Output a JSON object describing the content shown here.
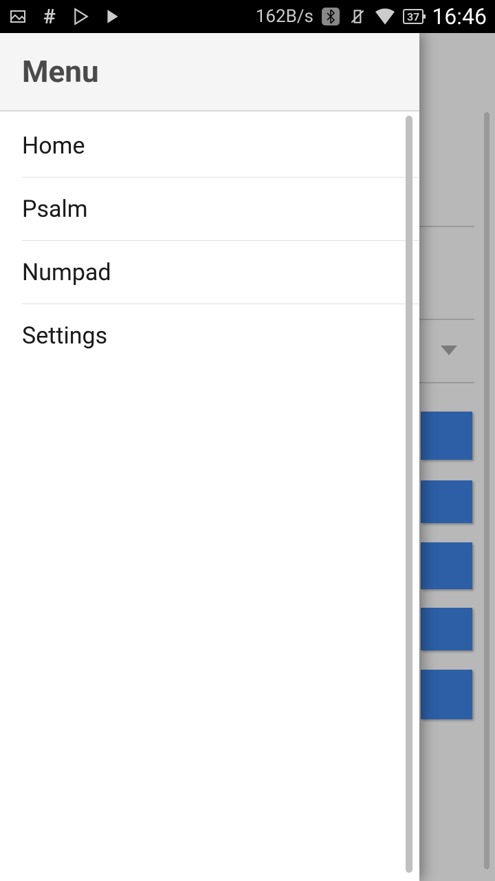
{
  "status_bar": {
    "data_rate": "162B/s",
    "battery_pct": "37",
    "time": "16:46"
  },
  "drawer": {
    "title": "Menu",
    "items": [
      {
        "label": "Home"
      },
      {
        "label": "Psalm"
      },
      {
        "label": "Numpad"
      },
      {
        "label": "Settings"
      }
    ]
  }
}
